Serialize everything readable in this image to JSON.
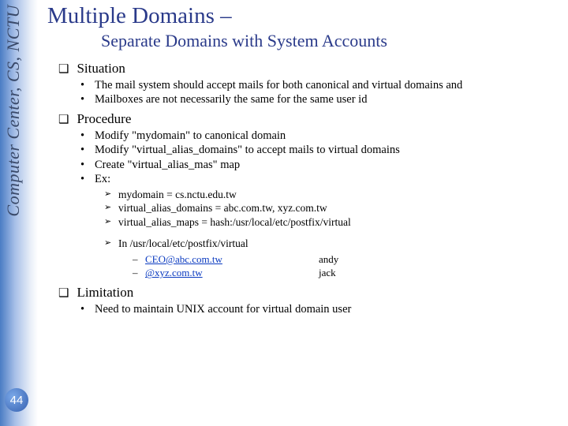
{
  "sidebar": {
    "label": "Computer Center, CS, NCTU"
  },
  "page_number": "44",
  "title": "Multiple Domains –",
  "subtitle": "Separate Domains with System Accounts",
  "sections": {
    "situation": {
      "heading": "Situation",
      "items": [
        "The mail system should accept mails for both canonical and virtual domains and",
        "Mailboxes are not necessarily the same for the same user id"
      ]
    },
    "procedure": {
      "heading": "Procedure",
      "items": [
        "Modify \"mydomain\" to canonical domain",
        "Modify \"virtual_alias_domains\" to accept mails to virtual domains",
        "Create \"virtual_alias_mas\" map",
        "Ex:"
      ],
      "sub_items": [
        "mydomain = cs.nctu.edu.tw",
        "virtual_alias_domains = abc.com.tw, xyz.com.tw",
        "virtual_alias_maps = hash:/usr/local/etc/postfix/virtual"
      ],
      "file_path": "In /usr/local/etc/postfix/virtual",
      "mappings": [
        {
          "addr": "CEO@abc.com.tw",
          "user": "andy"
        },
        {
          "addr": "@xyz.com.tw",
          "user": "jack"
        }
      ]
    },
    "limitation": {
      "heading": "Limitation",
      "items": [
        "Need to maintain UNIX account for virtual domain user"
      ]
    }
  }
}
